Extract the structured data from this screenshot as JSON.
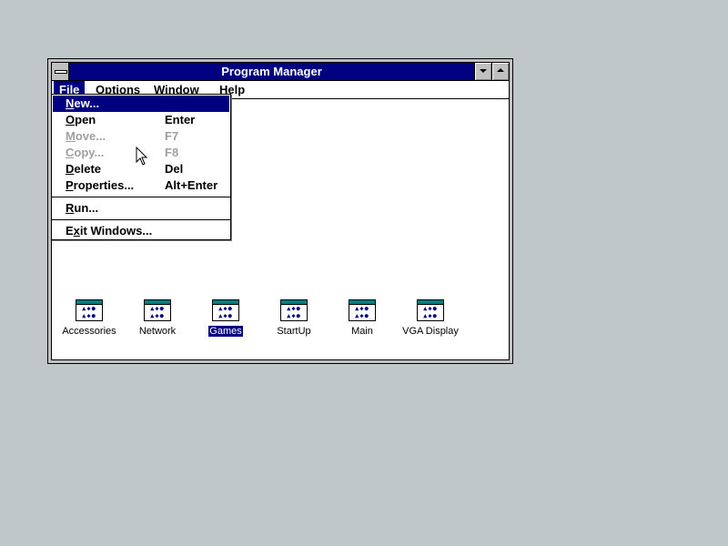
{
  "window": {
    "title": "Program Manager",
    "sysmenu_icon": "sysmenu-icon",
    "minimize_icon": "minimize-icon",
    "maximize_icon": "maximize-icon"
  },
  "menubar": {
    "file": {
      "u": "F",
      "rest": "ile"
    },
    "options": {
      "u": "O",
      "rest": "ptions"
    },
    "window": {
      "u": "W",
      "rest": "indow"
    },
    "help": {
      "u": "H",
      "rest": "elp"
    }
  },
  "file_menu": {
    "new": {
      "pre": "",
      "u": "N",
      "rest": "ew...",
      "key": ""
    },
    "open": {
      "pre": "",
      "u": "O",
      "rest": "pen",
      "key": "Enter"
    },
    "move": {
      "pre": "",
      "u": "M",
      "rest": "ove...",
      "key": "F7"
    },
    "copy": {
      "pre": "",
      "u": "C",
      "rest": "opy...",
      "key": "F8"
    },
    "delete": {
      "pre": "",
      "u": "D",
      "rest": "elete",
      "key": "Del"
    },
    "properties": {
      "pre": "",
      "u": "P",
      "rest": "roperties...",
      "key": "Alt+Enter"
    },
    "run": {
      "pre": "",
      "u": "R",
      "rest": "un...",
      "key": ""
    },
    "exit": {
      "pre": "E",
      "u": "x",
      "rest": "it Windows...",
      "key": ""
    }
  },
  "program_groups": [
    {
      "label": "Accessories",
      "selected": false
    },
    {
      "label": "Network",
      "selected": false
    },
    {
      "label": "Games",
      "selected": true
    },
    {
      "label": "StartUp",
      "selected": false
    },
    {
      "label": "Main",
      "selected": false
    },
    {
      "label": "VGA Display",
      "selected": false
    }
  ],
  "colors": {
    "desktop": "#c0c7c8",
    "titlebar": "#000080",
    "highlight": "#000080",
    "disabled_text": "#a0a0a0"
  },
  "cursor_icon": "arrow-cursor-icon"
}
